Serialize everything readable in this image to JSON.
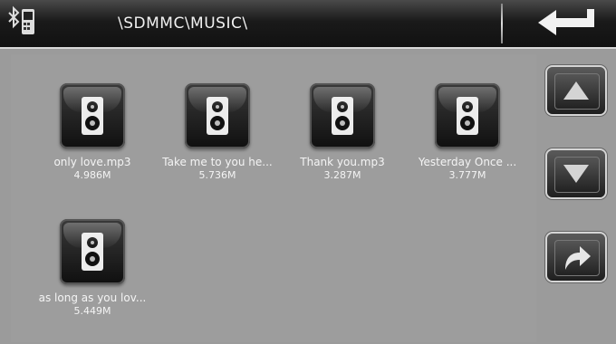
{
  "header": {
    "path": "\\SDMMC\\MUSIC\\",
    "status_icons": [
      "bluetooth-icon",
      "phone-icon"
    ],
    "back_icon": "back-arrow-icon"
  },
  "files": [
    {
      "name": "only love.mp3",
      "size": "4.986M",
      "icon": "speaker-icon"
    },
    {
      "name": "Take me to you he...",
      "size": "5.736M",
      "icon": "speaker-icon"
    },
    {
      "name": "Thank you.mp3",
      "size": "3.287M",
      "icon": "speaker-icon"
    },
    {
      "name": "Yesterday Once ...",
      "size": "3.777M",
      "icon": "speaker-icon"
    },
    {
      "name": "as long as you lov...",
      "size": "5.449M",
      "icon": "speaker-icon"
    }
  ],
  "sidebar": {
    "buttons": [
      {
        "name": "scroll-up-button",
        "icon": "triangle-up-icon"
      },
      {
        "name": "scroll-down-button",
        "icon": "triangle-down-icon"
      },
      {
        "name": "enter-button",
        "icon": "curved-arrow-icon"
      }
    ]
  },
  "colors": {
    "background": "#9b9b9b",
    "topbar": "#111111",
    "text": "#f4f4f4"
  }
}
